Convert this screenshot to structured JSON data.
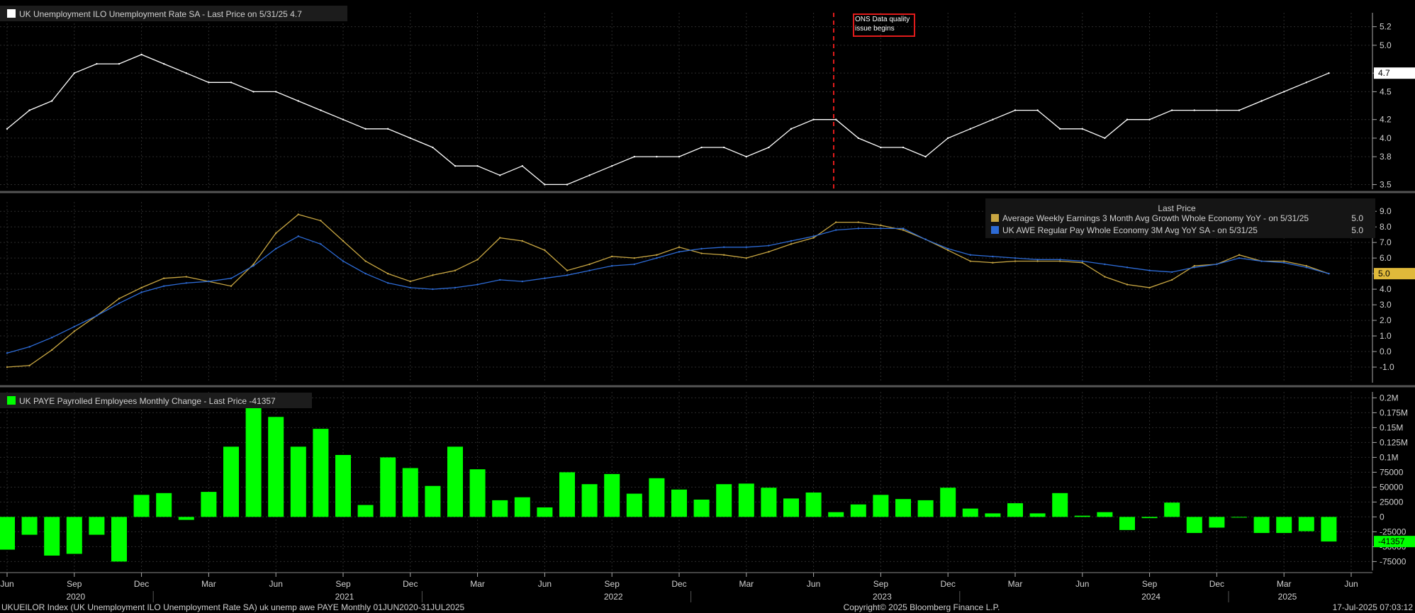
{
  "chart_data": {
    "type": "composite",
    "x_axis": {
      "month_ticks": [
        "Jun",
        "Sep",
        "Dec",
        "Mar",
        "Jun",
        "Sep",
        "Dec",
        "Mar",
        "Jun",
        "Sep",
        "Dec",
        "Mar",
        "Jun",
        "Sep",
        "Dec",
        "Mar",
        "Jun",
        "Sep",
        "Dec",
        "Mar",
        "Jun"
      ],
      "year_labels": [
        "2020",
        "2021",
        "2022",
        "2023",
        "2024",
        "2025"
      ]
    },
    "panels": [
      {
        "type": "line",
        "legend": "UK Unemployment ILO Unemployment Rate SA - Last Price on 5/31/25 4.7",
        "legend_color": "#ffffff",
        "y_ticks": [
          "5.2",
          "5.0",
          "4.7",
          "4.5",
          "4.2",
          "4.0",
          "3.8",
          "3.5"
        ],
        "ylim": [
          3.45,
          5.35
        ],
        "last_value_label": "4.7",
        "annotation": "ONS Data quality issue begins",
        "series": [
          {
            "color": "#ffffff",
            "values": [
              4.1,
              4.3,
              4.4,
              4.7,
              4.8,
              4.8,
              4.9,
              4.8,
              4.7,
              4.6,
              4.6,
              4.5,
              4.5,
              4.4,
              4.3,
              4.2,
              4.1,
              4.1,
              4.0,
              3.9,
              3.7,
              3.7,
              3.6,
              3.7,
              3.5,
              3.5,
              3.6,
              3.7,
              3.8,
              3.8,
              3.8,
              3.9,
              3.9,
              3.8,
              3.9,
              4.1,
              4.2,
              4.2,
              4.0,
              3.9,
              3.9,
              3.8,
              4.0,
              4.1,
              4.2,
              4.3,
              4.3,
              4.1,
              4.1,
              4.0,
              4.2,
              4.2,
              4.3,
              4.3,
              4.3,
              4.3,
              4.4,
              4.5,
              4.6,
              4.7
            ]
          }
        ]
      },
      {
        "type": "line",
        "legend_title": "Last Price",
        "y_ticks": [
          "9.0",
          "8.0",
          "7.0",
          "6.0",
          "5.0",
          "4.0",
          "3.0",
          "2.0",
          "1.0",
          "0.0",
          "-1.0"
        ],
        "ylim": [
          -2.0,
          9.6
        ],
        "last_value_label": "5.0",
        "series": [
          {
            "name": "Average Weekly Earnings 3 Month Avg Growth Whole Economy YoY -   on 5/31/25",
            "last": "5.0",
            "color": "#c8a642",
            "values": [
              -1.0,
              -0.9,
              0.1,
              1.3,
              2.3,
              3.4,
              4.1,
              4.7,
              4.8,
              4.5,
              4.2,
              5.6,
              7.6,
              8.8,
              8.4,
              7.1,
              5.8,
              5.0,
              4.5,
              4.9,
              5.2,
              5.9,
              7.3,
              7.1,
              6.5,
              5.2,
              5.6,
              6.1,
              6.0,
              6.2,
              6.7,
              6.3,
              6.2,
              6.0,
              6.4,
              6.9,
              7.3,
              8.3,
              8.3,
              8.1,
              7.8,
              7.2,
              6.5,
              5.8,
              5.7,
              5.8,
              5.8,
              5.8,
              5.7,
              4.8,
              4.3,
              4.1,
              4.6,
              5.5,
              5.6,
              6.2,
              5.8,
              5.8,
              5.5,
              5.0
            ]
          },
          {
            "name": "UK AWE Regular Pay Whole Economy 3M Avg YoY SA -   on 5/31/25",
            "last": "5.0",
            "color": "#2d6bd6",
            "values": [
              -0.1,
              0.3,
              0.9,
              1.6,
              2.3,
              3.1,
              3.8,
              4.2,
              4.4,
              4.5,
              4.7,
              5.5,
              6.6,
              7.4,
              6.9,
              5.8,
              5.0,
              4.4,
              4.1,
              4.0,
              4.1,
              4.3,
              4.6,
              4.5,
              4.7,
              4.9,
              5.2,
              5.5,
              5.6,
              6.0,
              6.4,
              6.6,
              6.7,
              6.7,
              6.8,
              7.1,
              7.4,
              7.8,
              7.9,
              7.9,
              7.9,
              7.2,
              6.6,
              6.2,
              6.1,
              6.0,
              5.9,
              5.9,
              5.8,
              5.6,
              5.4,
              5.2,
              5.1,
              5.4,
              5.6,
              6.0,
              5.8,
              5.7,
              5.4,
              5.0
            ]
          }
        ]
      },
      {
        "type": "bar",
        "legend": "UK PAYE Payrolled Employees Monthly Change - Last Price -41357",
        "legend_color": "#00ff00",
        "y_ticks": [
          "0.2M",
          "0.175M",
          "0.15M",
          "0.125M",
          "0.1M",
          "75000",
          "50000",
          "25000",
          "0",
          "-25000",
          "-50000",
          "-75000"
        ],
        "ylim": [
          -90000,
          210000
        ],
        "last_value_label": "-41357",
        "series": [
          {
            "name": "UK PAYE Payrolled Employees Monthly Change",
            "color": "#00ff00",
            "values": [
              -55000,
              -30000,
              -65000,
              -62000,
              -30000,
              -75000,
              37000,
              40000,
              -5000,
              42000,
              118000,
              185000,
              168000,
              118000,
              148000,
              104000,
              20000,
              100000,
              82000,
              52000,
              118000,
              80000,
              28000,
              33000,
              16000,
              75000,
              55000,
              72000,
              39000,
              65000,
              46000,
              29000,
              55000,
              56000,
              49000,
              31000,
              41000,
              8000,
              21000,
              37000,
              30000,
              28000,
              49000,
              14000,
              6000,
              23000,
              6000,
              40000,
              2000,
              8000,
              -22000,
              -2000,
              24000,
              -27000,
              -18000,
              -1000,
              -27000,
              -27000,
              -24000,
              -41357
            ]
          }
        ]
      }
    ]
  },
  "footer": {
    "left": "UKUEILOR Index (UK Unemployment ILO Unemployment Rate SA) uk unemp awe PAYE  Monthly 01JUN2020-31JUL2025",
    "center": "Copyright© 2025 Bloomberg Finance L.P.",
    "right": "17-Jul-2025 07:03:12"
  }
}
